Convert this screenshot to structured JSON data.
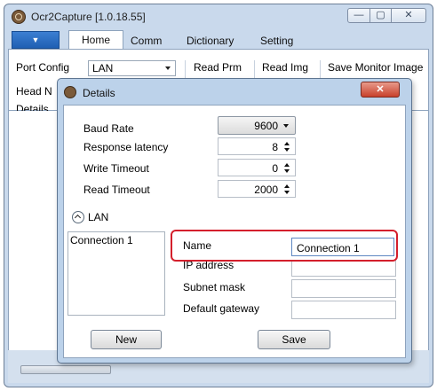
{
  "window": {
    "title": "Ocr2Capture [1.0.18.55]",
    "controls": {
      "minimize": "—",
      "maximize": "▢",
      "close": "✕"
    }
  },
  "ribbon": {
    "file_tab_label": "▼",
    "tabs": [
      "Home",
      "Comm",
      "Dictionary",
      "Setting"
    ],
    "port_config_label": "Port Config",
    "port_config_value": "LAN",
    "commands": [
      "Read Prm",
      "Read Img",
      "Save Monitor Image"
    ],
    "head_label": "Head N",
    "details_label": "Details"
  },
  "details_dialog": {
    "title": "Details",
    "close_label": "✕",
    "fields": {
      "baud_rate": {
        "label": "Baud Rate",
        "value": "9600"
      },
      "response_latency": {
        "label": "Response latency",
        "value": "8"
      },
      "write_timeout": {
        "label": "Write Timeout",
        "value": "0"
      },
      "read_timeout": {
        "label": "Read Timeout",
        "value": "2000"
      }
    },
    "lan_section": {
      "label": "LAN",
      "connections": [
        "Connection 1"
      ],
      "name_label": "Name",
      "name_value": "Connection 1",
      "ip_label": "IP address",
      "subnet_label": "Subnet mask",
      "gateway_label": "Default gateway"
    },
    "buttons": {
      "new": "New",
      "save": "Save"
    }
  },
  "colors": {
    "highlight": "#d41f2c",
    "window_frame": "#c9d9ec",
    "file_tab": "#1f5fb3"
  }
}
